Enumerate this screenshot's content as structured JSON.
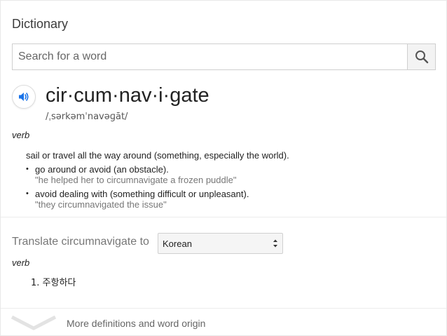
{
  "card": {
    "title": "Dictionary"
  },
  "search": {
    "placeholder": "Search for a word",
    "value": ""
  },
  "entry": {
    "headword": "cir·cum·nav·i·gate",
    "pronunciation": "/ˌsərkəmˈnavəɡāt/",
    "part_of_speech": "verb",
    "main_definition": "sail or travel all the way around (something, especially the world).",
    "sub_senses": [
      {
        "definition": "go around or avoid (an obstacle).",
        "example": "\"he helped her to circumnavigate a frozen puddle\""
      },
      {
        "definition": "avoid dealing with (something difficult or unpleasant).",
        "example": "\"they circumnavigated the issue\""
      }
    ]
  },
  "translate": {
    "label": "Translate circumnavigate to",
    "selected_language": "Korean",
    "part_of_speech": "verb",
    "results": [
      "1. 주항하다"
    ]
  },
  "footer": {
    "more_label": "More definitions and word origin"
  },
  "icons": {
    "search": "search-icon",
    "speaker": "speaker-icon",
    "select_arrows": "select-arrows-icon",
    "expand": "chevron-down-icon"
  },
  "colors": {
    "accent_blue": "#1a73e8",
    "example_gray": "#777777",
    "divider": "#ececec"
  }
}
